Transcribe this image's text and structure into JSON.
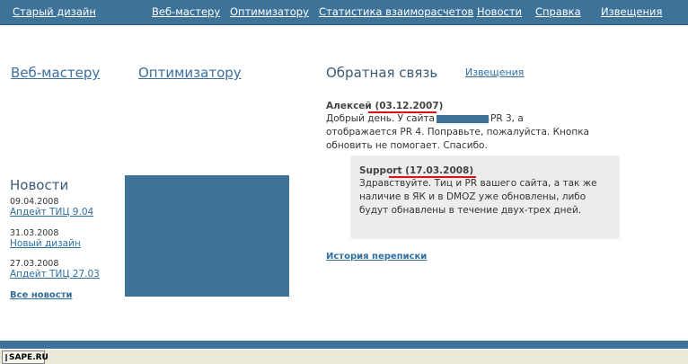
{
  "nav": {
    "items": [
      "Старый дизайн",
      "Веб-мастеру",
      "Оптимизатору",
      "Статистика взаиморасчетов",
      "Новости",
      "Справка",
      "Извещения"
    ]
  },
  "columns": {
    "webmaster": "Веб-мастеру",
    "optimizer": "Оптимизатору"
  },
  "feedback": {
    "title": "Обратная связь",
    "notices_link": "Извещения",
    "message": {
      "author": "Алексей",
      "date": "(03.12.2007)",
      "text_before": "Добрый день. У сайта",
      "text_after": "PR 3, а отображается PR 4. Поправьте, пожалуйста. Кнопка обновить не помогает. Спасибо."
    },
    "reply": {
      "author": "Support",
      "date": "(17.03.2008)",
      "text": "Здравствуйте. Тиц и PR вашего сайта, а так же наличие в ЯК и в DMOZ уже обновлены, либо будут обнавлены в течение двух-трех дней."
    },
    "history_link": "История переписки"
  },
  "news": {
    "title": "Новости",
    "items": [
      {
        "date": "09.04.2008",
        "link": "Апдейт ТИЦ 9.04"
      },
      {
        "date": "31.03.2008",
        "link": "Новый дизайн"
      },
      {
        "date": "27.03.2008",
        "link": "Апдейт ТИЦ 27.03"
      }
    ],
    "all_link": "Все новости"
  },
  "taskbar": {
    "label": "SAPE.RU"
  },
  "colors": {
    "brand_blue": "#3d7299",
    "link_blue": "#2f6f9f",
    "highlight_red": "#e01010",
    "reply_bg": "#ededed"
  }
}
